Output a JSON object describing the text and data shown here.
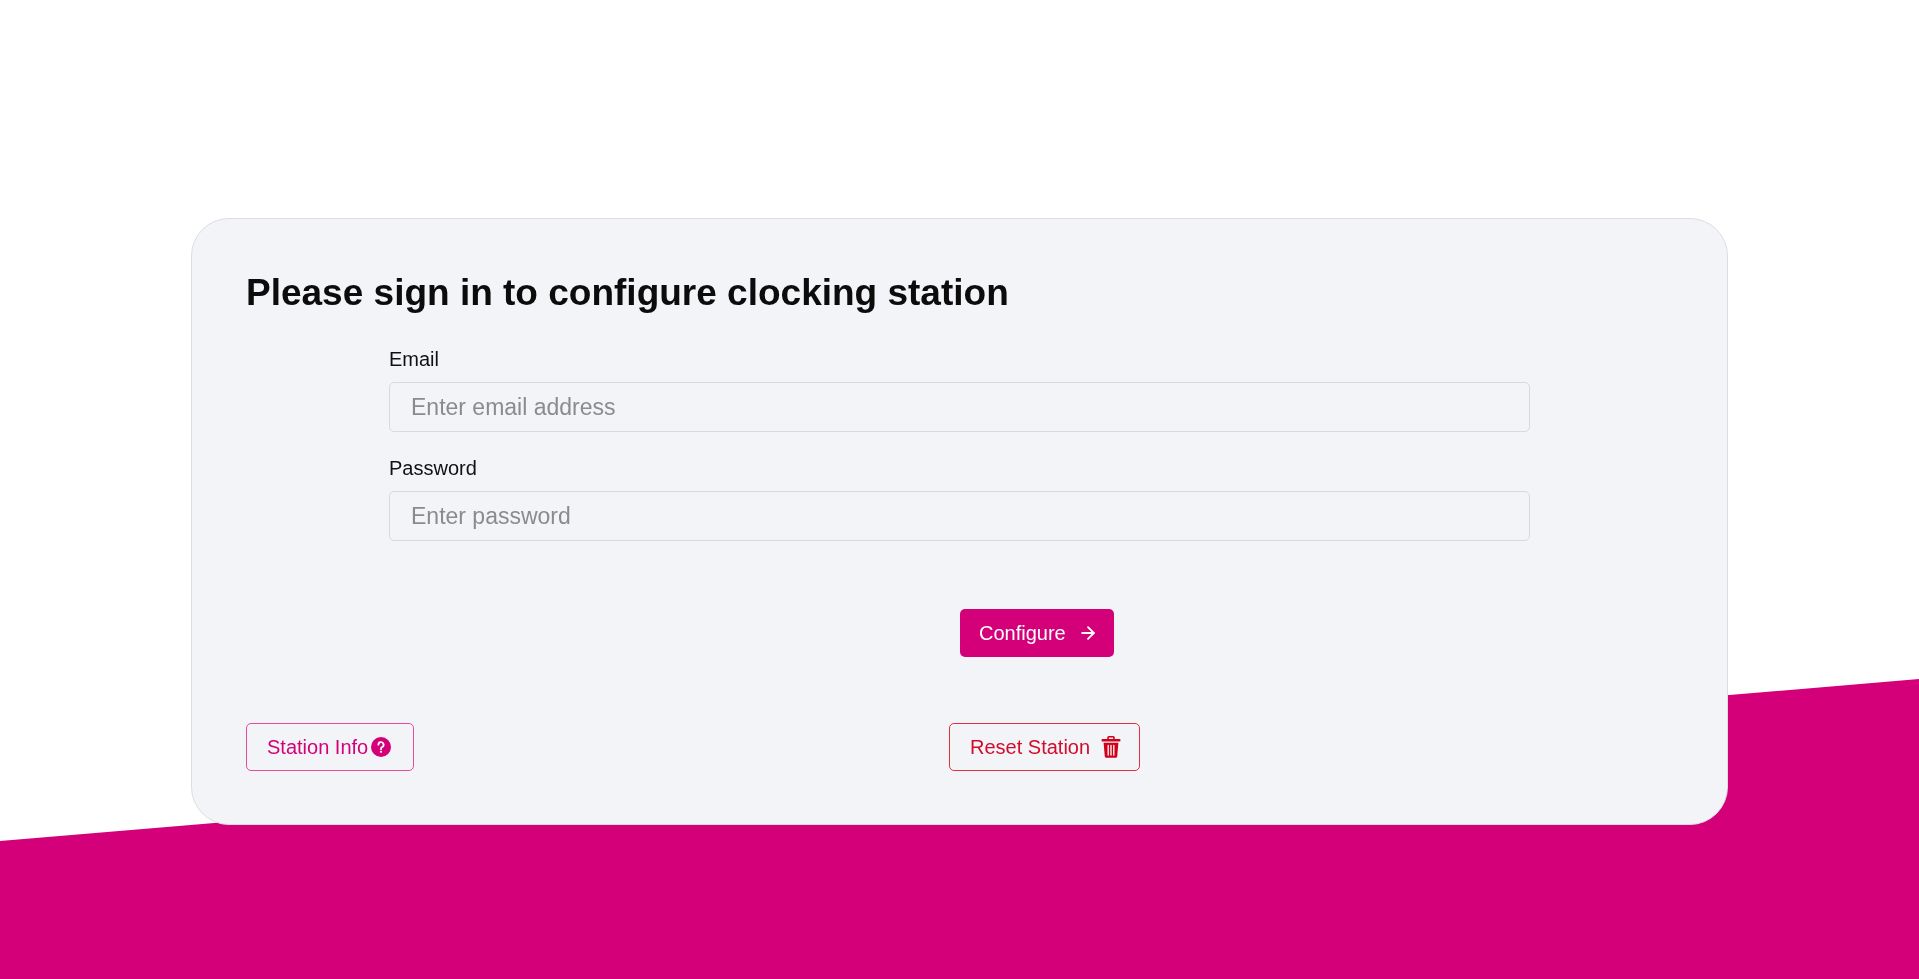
{
  "heading": "Please sign in to configure clocking station",
  "fields": [
    {
      "label": "Email",
      "placeholder": "Enter email address"
    },
    {
      "label": "Password",
      "placeholder": "Enter password"
    }
  ],
  "submit_button": {
    "label": "Configure"
  },
  "footer_buttons": [
    {
      "label": "Station Info",
      "kind": "info"
    },
    {
      "label": "Reset Station",
      "kind": "danger"
    }
  ]
}
